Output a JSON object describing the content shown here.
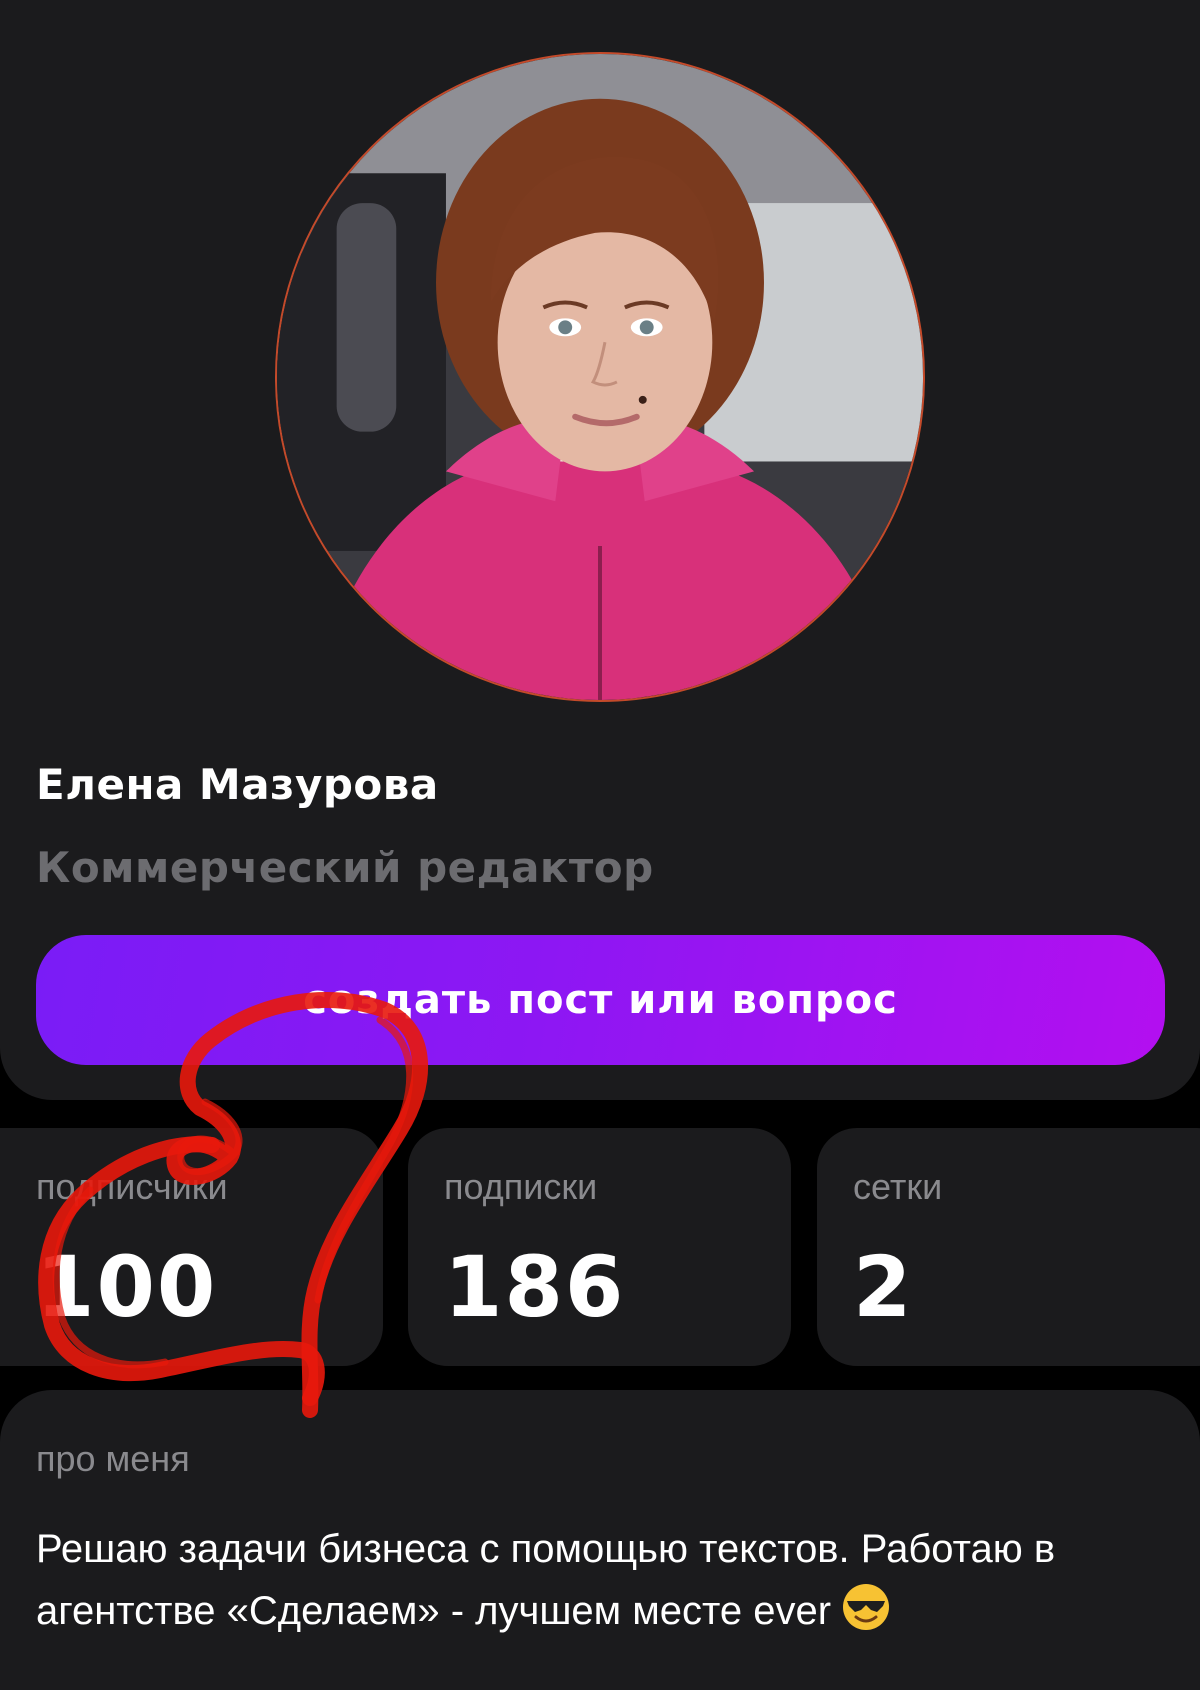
{
  "profile": {
    "name": "Елена Мазурова",
    "role": "Коммерческий редактор",
    "create_button_label": "создать пост или вопрос"
  },
  "stats": [
    {
      "label": "подписчики",
      "value": "100"
    },
    {
      "label": "подписки",
      "value": "186"
    },
    {
      "label": "сетки",
      "value": "2"
    }
  ],
  "about": {
    "heading": "про меня",
    "text": "Решаю задачи бизнеса с помощью текстов. Работаю в агентстве «Сделаем» - лучшем месте ever",
    "emoji_icon": "sunglasses-emoji-icon"
  },
  "colors": {
    "background": "#000000",
    "card": "#1b1b1d",
    "muted_text": "#8a8a8e",
    "button_gradient_start": "#7a1cf6",
    "button_gradient_end": "#b30ff0",
    "annotation_red": "#e8180c"
  }
}
